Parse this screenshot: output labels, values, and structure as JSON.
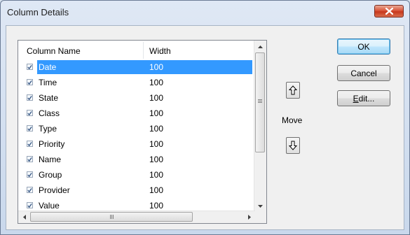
{
  "window": {
    "title": "Column Details"
  },
  "list": {
    "headers": {
      "name": "Column Name",
      "width": "Width"
    },
    "rows": [
      {
        "name": "Date",
        "width": "100",
        "checked": true,
        "selected": true
      },
      {
        "name": "Time",
        "width": "100",
        "checked": true
      },
      {
        "name": "State",
        "width": "100",
        "checked": true
      },
      {
        "name": "Class",
        "width": "100",
        "checked": true
      },
      {
        "name": "Type",
        "width": "100",
        "checked": true
      },
      {
        "name": "Priority",
        "width": "100",
        "checked": true
      },
      {
        "name": "Name",
        "width": "100",
        "checked": true
      },
      {
        "name": "Group",
        "width": "100",
        "checked": true
      },
      {
        "name": "Provider",
        "width": "100",
        "checked": true
      },
      {
        "name": "Value",
        "width": "100",
        "checked": true
      }
    ]
  },
  "move": {
    "label": "Move"
  },
  "buttons": {
    "ok": "OK",
    "cancel": "Cancel",
    "edit_prefix": "",
    "edit_mnemonic": "E",
    "edit_rest": "dit..."
  },
  "colors": {
    "selection": "#3399ff",
    "close": "#c7381c",
    "window_frame": "#c9d8ec"
  }
}
